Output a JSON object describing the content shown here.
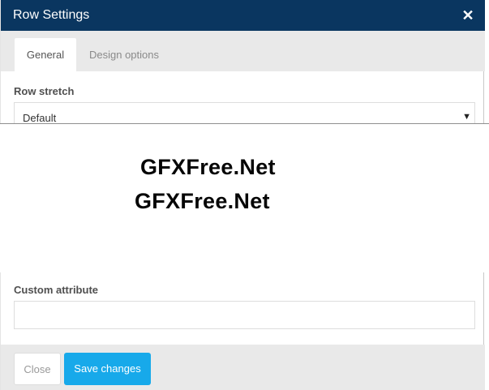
{
  "dialog": {
    "title": "Row Settings",
    "close_icon": "close-icon",
    "close_glyph": "✕"
  },
  "tabs": [
    {
      "label": "General",
      "active": true
    },
    {
      "label": "Design options",
      "active": false
    }
  ],
  "row_stretch": {
    "label": "Row stretch",
    "value": "Default",
    "arrow_icon": "caret-down-icon",
    "arrow_glyph": "▼"
  },
  "watermark": [
    "GFXFree.Net",
    "GFXFree.Net"
  ],
  "custom_attribute": {
    "label": "Custom attribute",
    "value": ""
  },
  "footer": {
    "close_label": "Close",
    "save_label": "Save changes"
  },
  "colors": {
    "titlebar": "#0a3660",
    "save_button": "#17a9ea",
    "panel_gray": "#e9e9e9"
  }
}
